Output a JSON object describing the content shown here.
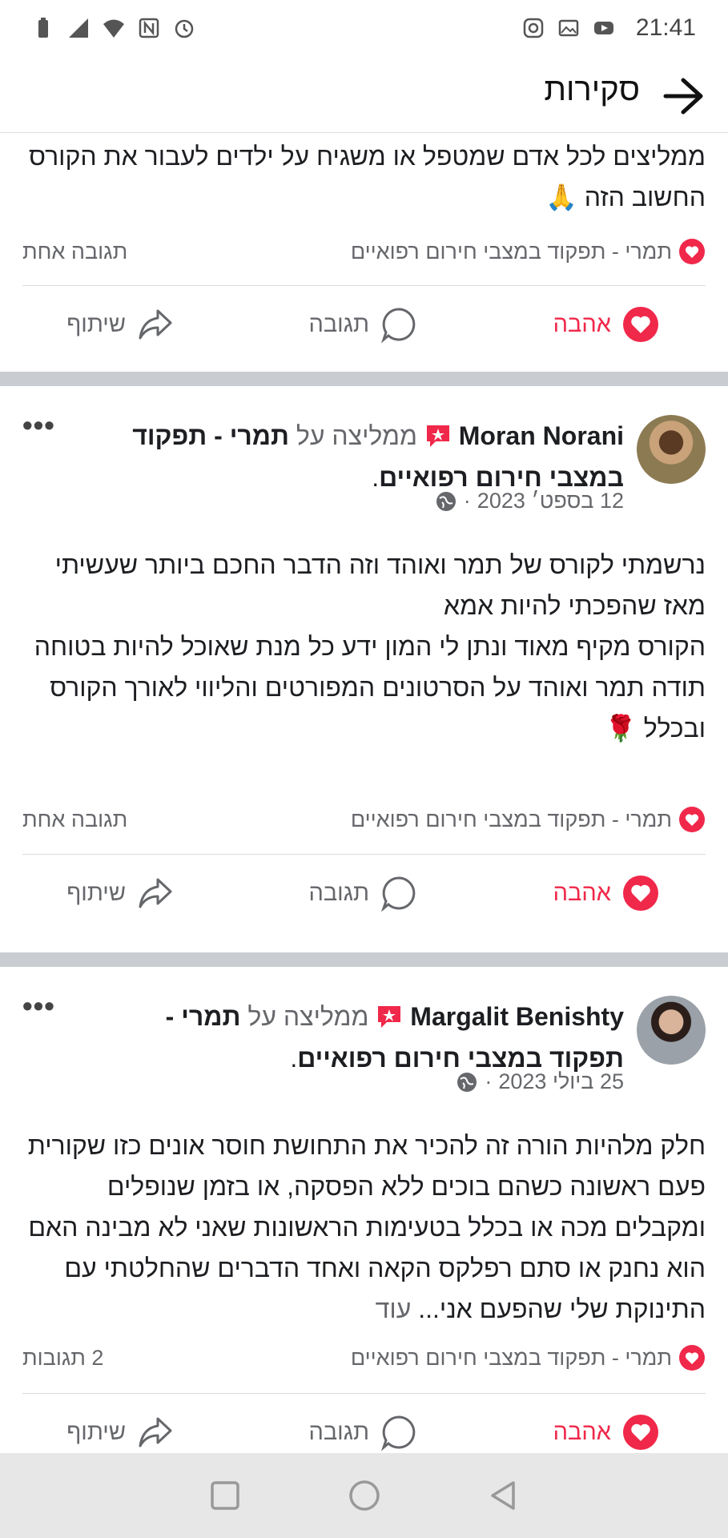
{
  "status_bar": {
    "time": "21:41"
  },
  "header": {
    "title": "סקירות"
  },
  "top_post": {
    "text": "ממליצים לכל אדם שמטפל או משגיח על ילדים לעבור את הקורס החשוב הזה 🙏",
    "page_name": "תמרי - תפקוד במצבי חירום רפואיים",
    "reply_count": "תגובה אחת"
  },
  "actions": {
    "love": "אהבה",
    "comment": "תגובה",
    "share": "שיתוף"
  },
  "posts": [
    {
      "author": "Moran Norani",
      "recommends": "ממליצה על",
      "page_name": "תמרי - תפקוד במצבי חירום רפואיים",
      "date": "12 בספט׳ 2023",
      "text": "נרשמתי לקורס של תמר ואוהד וזה הדבר החכם ביותר שעשיתי מאז שהפכתי להיות אמא\nהקורס מקיף מאוד ונתן לי המון ידע כל מנת שאוכל להיות בטוחה\nתודה תמר ואוהד על הסרטונים המפורטים והליווי לאורך הקורס ובכלל 🌹",
      "reply_count": "תגובה אחת"
    },
    {
      "author": "Margalit Benishty",
      "recommends": "ממליצה על",
      "page_name": "תמרי - תפקוד במצבי חירום רפואיים",
      "date": "25 ביולי 2023",
      "text": "חלק מלהיות הורה זה להכיר את התחושת חוסר אונים כזו שקורית פעם ראשונה כשהם בוכים ללא הפסקה, או בזמן שנופלים ומקבלים מכה או בכלל בטעימות הראשונות שאני לא מבינה האם הוא נחנק או סתם רפלקס הקאה ואחד הדברים שהחלטתי עם התינוקת שלי שהפעם אני...",
      "more": "עוד",
      "reply_count": "2 תגובות"
    }
  ],
  "colors": {
    "love": "#f0284a",
    "muted": "#65676b",
    "separator": "#c9ccd1"
  }
}
